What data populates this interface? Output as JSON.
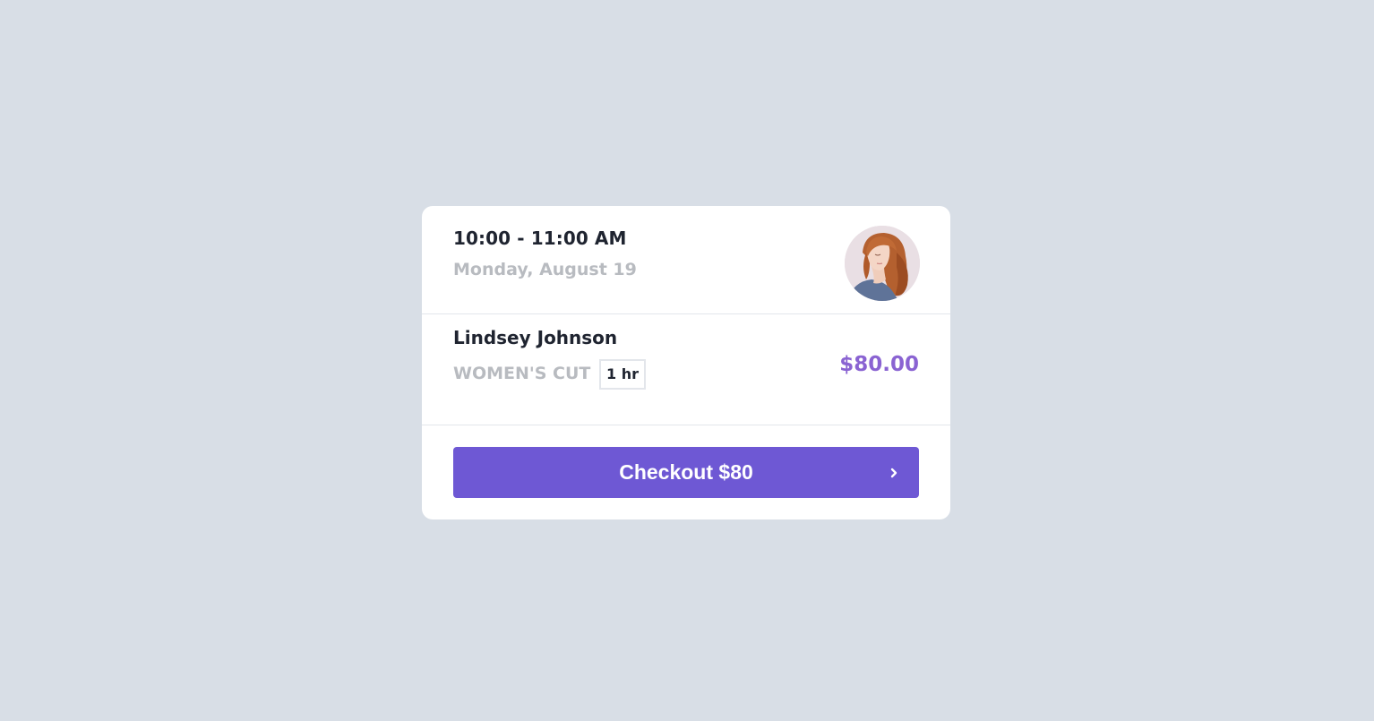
{
  "appointment": {
    "time_range": "10:00 - 11:00 AM",
    "date": "Monday, August 19"
  },
  "client": {
    "name": "Lindsey Johnson",
    "service": "WOMEN'S CUT",
    "duration": "1 hr",
    "price": "$80.00"
  },
  "checkout": {
    "label": "Checkout $80",
    "icon": "chevron-right-icon"
  },
  "colors": {
    "background": "#d8dee6",
    "accent": "#6e58d4",
    "price": "#8a63d2",
    "muted_text": "#b8bbc0",
    "primary_text": "#1f2430"
  }
}
